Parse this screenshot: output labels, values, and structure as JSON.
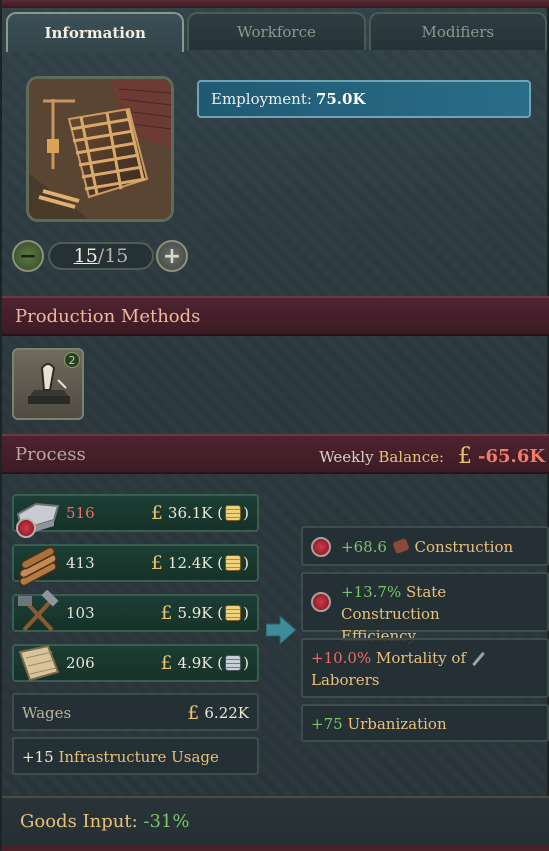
{
  "tabs": [
    {
      "label": "Information"
    },
    {
      "label": "Workforce"
    },
    {
      "label": "Modifiers"
    }
  ],
  "building": {
    "level_current": "15",
    "level_separator": "/",
    "level_max": "15"
  },
  "employment": {
    "label": "Employment:",
    "value": "75.0K"
  },
  "production_methods": {
    "title": "Production Methods",
    "method_badge": "2"
  },
  "process": {
    "title": "Process",
    "weekly_label_prefix": "Weekly",
    "weekly_label_suffix": "Balance:",
    "currency_symbol": "£",
    "weekly_balance": "-65.6K"
  },
  "inputs": [
    {
      "icon": "iron-icon",
      "amount": "516",
      "price": "36.1K",
      "coin": "gold",
      "shortage": true
    },
    {
      "icon": "wood-icon",
      "amount": "413",
      "price": "12.4K",
      "coin": "gold",
      "shortage": false
    },
    {
      "icon": "tools-icon",
      "amount": "103",
      "price": "5.9K",
      "coin": "gold",
      "shortage": false
    },
    {
      "icon": "fabric-icon",
      "amount": "206",
      "price": "4.9K",
      "coin": "silver",
      "shortage": false
    }
  ],
  "wages": {
    "label": "Wages",
    "value": "6.22K"
  },
  "infrastructure": {
    "value": "+15",
    "label": "Infrastructure Usage"
  },
  "outputs": [
    {
      "value": "+68.6",
      "label": "Construction"
    },
    {
      "value": "+13.7%",
      "label_line1": "State Construction",
      "label_line2": "Efficiency"
    },
    {
      "value": "+10.0%",
      "label_line1": "Mortality of",
      "label_line2": "Laborers"
    },
    {
      "value": "+75",
      "label": "Urbanization"
    }
  ],
  "footer": {
    "label": "Goods Input:",
    "value": "-31%"
  },
  "colors": {
    "header_red": "#4e2330",
    "positive": "#79c46a",
    "negative": "#ef6b66",
    "gold": "#e8c07a",
    "employment_bar": "#2a6d88"
  }
}
